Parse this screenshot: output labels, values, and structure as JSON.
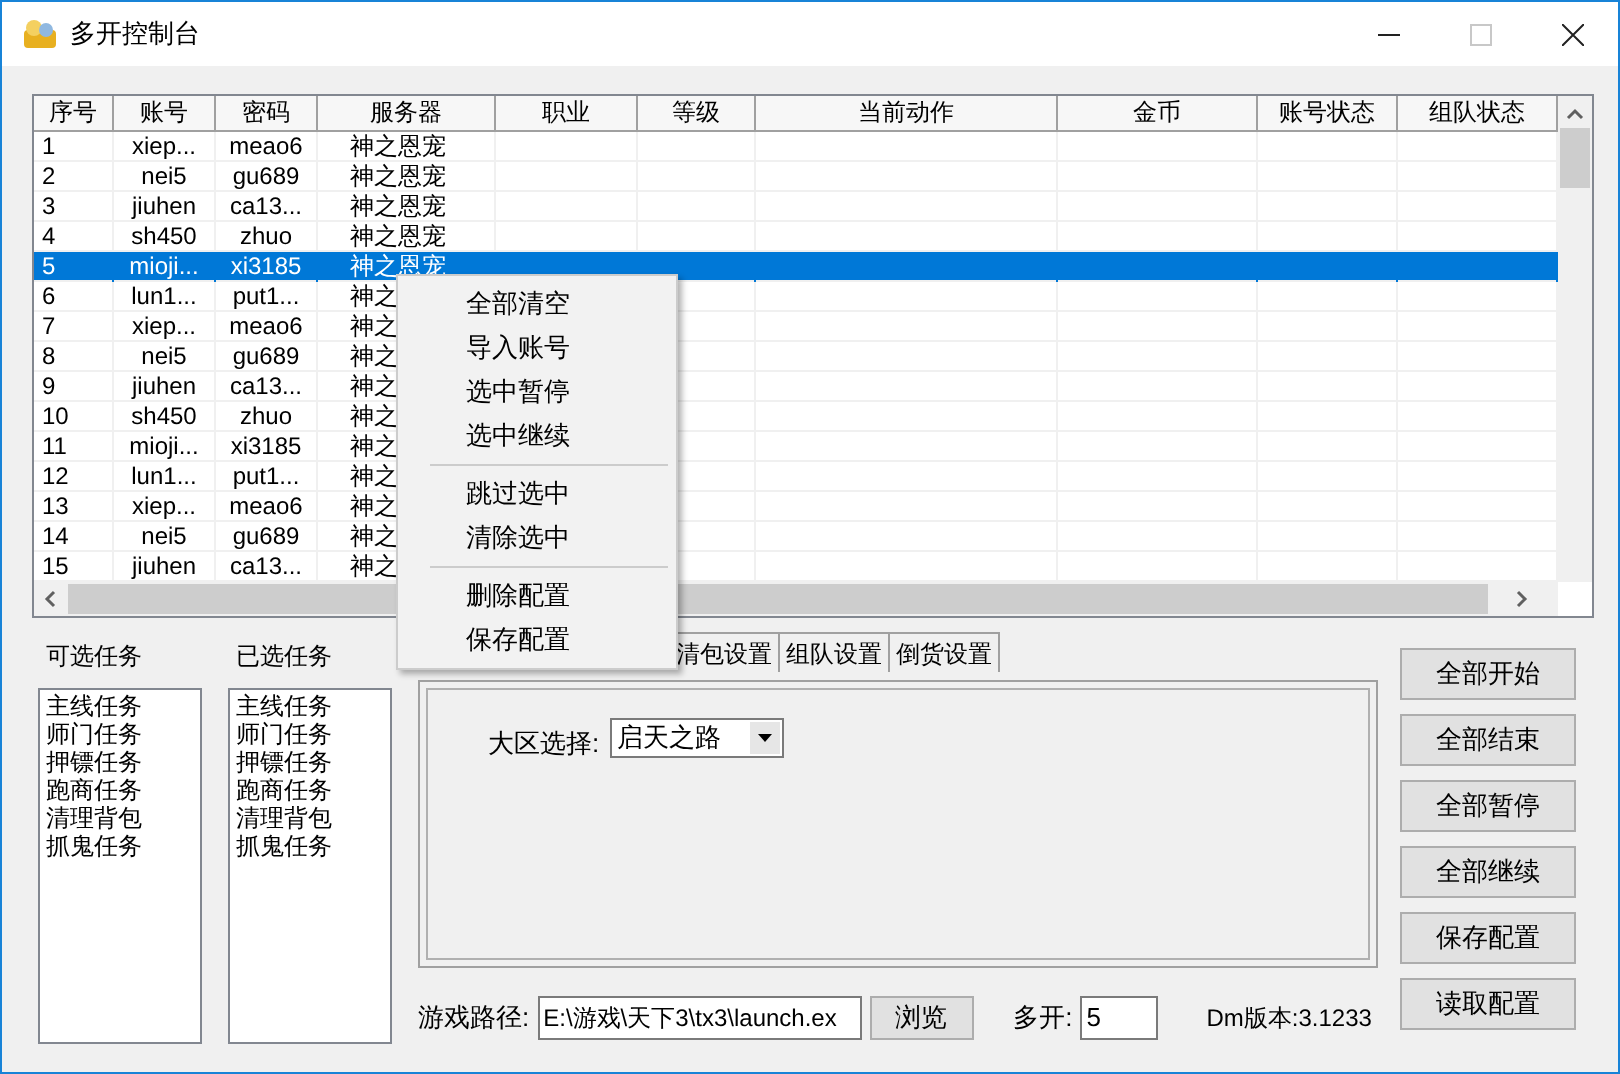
{
  "window": {
    "title": "多开控制台",
    "controls": [
      {
        "kind": "minimize",
        "disabled": false
      },
      {
        "kind": "maximize",
        "disabled": true
      },
      {
        "kind": "close",
        "disabled": false
      }
    ]
  },
  "table": {
    "columns": [
      "序号",
      "账号",
      "密码",
      "服务器",
      "职业",
      "等级",
      "当前动作",
      "金币",
      "账号状态",
      "组队状态"
    ],
    "rows": [
      {
        "cells": [
          "1",
          "xiep...",
          "meao6",
          "神之恩宠"
        ],
        "selected": false
      },
      {
        "cells": [
          "2",
          "nei5",
          "gu689",
          "神之恩宠"
        ],
        "selected": false
      },
      {
        "cells": [
          "3",
          "jiuhen",
          "ca13...",
          "神之恩宠"
        ],
        "selected": false
      },
      {
        "cells": [
          "4",
          "sh450",
          "zhuo",
          "神之恩宠"
        ],
        "selected": false
      },
      {
        "cells": [
          "5",
          "mioji...",
          "xi3185",
          "神之恩宠"
        ],
        "selected": true
      },
      {
        "cells": [
          "6",
          "lun1...",
          "put1...",
          "神之"
        ],
        "selected": false
      },
      {
        "cells": [
          "7",
          "xiep...",
          "meao6",
          "神之"
        ],
        "selected": false
      },
      {
        "cells": [
          "8",
          "nei5",
          "gu689",
          "神之"
        ],
        "selected": false
      },
      {
        "cells": [
          "9",
          "jiuhen",
          "ca13...",
          "神之"
        ],
        "selected": false
      },
      {
        "cells": [
          "10",
          "sh450",
          "zhuo",
          "神之"
        ],
        "selected": false
      },
      {
        "cells": [
          "11",
          "mioji...",
          "xi3185",
          "神之"
        ],
        "selected": false
      },
      {
        "cells": [
          "12",
          "lun1...",
          "put1...",
          "神之"
        ],
        "selected": false
      },
      {
        "cells": [
          "13",
          "xiep...",
          "meao6",
          "神之"
        ],
        "selected": false
      },
      {
        "cells": [
          "14",
          "nei5",
          "gu689",
          "神之"
        ],
        "selected": false
      },
      {
        "cells": [
          "15",
          "jiuhen",
          "ca13...",
          "神之"
        ],
        "selected": false
      }
    ]
  },
  "context_menu": [
    {
      "kind": "item",
      "label": "全部清空"
    },
    {
      "kind": "item",
      "label": "导入账号"
    },
    {
      "kind": "item",
      "label": "选中暂停"
    },
    {
      "kind": "item",
      "label": "选中继续"
    },
    {
      "kind": "separator"
    },
    {
      "kind": "item",
      "label": "跳过选中"
    },
    {
      "kind": "item",
      "label": "清除选中"
    },
    {
      "kind": "separator"
    },
    {
      "kind": "item",
      "label": "删除配置"
    },
    {
      "kind": "item",
      "label": "保存配置"
    }
  ],
  "available_tasks": {
    "label": "可选任务",
    "items": [
      "主线任务",
      "师门任务",
      "押镖任务",
      "跑商任务",
      "清理背包",
      "抓鬼任务"
    ]
  },
  "selected_tasks": {
    "label": "已选任务",
    "items": [
      "主线任务",
      "师门任务",
      "押镖任务",
      "跑商任务",
      "清理背包",
      "抓鬼任务"
    ]
  },
  "tabs": [
    {
      "label": "清包设置",
      "selected": false
    },
    {
      "label": "组队设置",
      "selected": false
    },
    {
      "label": "倒货设置",
      "selected": false
    }
  ],
  "region": {
    "label": "大区选择:",
    "value": "启天之路"
  },
  "game_path": {
    "label": "游戏路径:",
    "value": "E:\\游戏\\天下3\\tx3\\launch.ex",
    "browse": "浏览"
  },
  "multi_open": {
    "label": "多开:",
    "value": "5"
  },
  "version": "Dm版本:3.1233",
  "buttons": [
    "全部开始",
    "全部结束",
    "全部暂停",
    "全部继续",
    "保存配置",
    "读取配置"
  ]
}
